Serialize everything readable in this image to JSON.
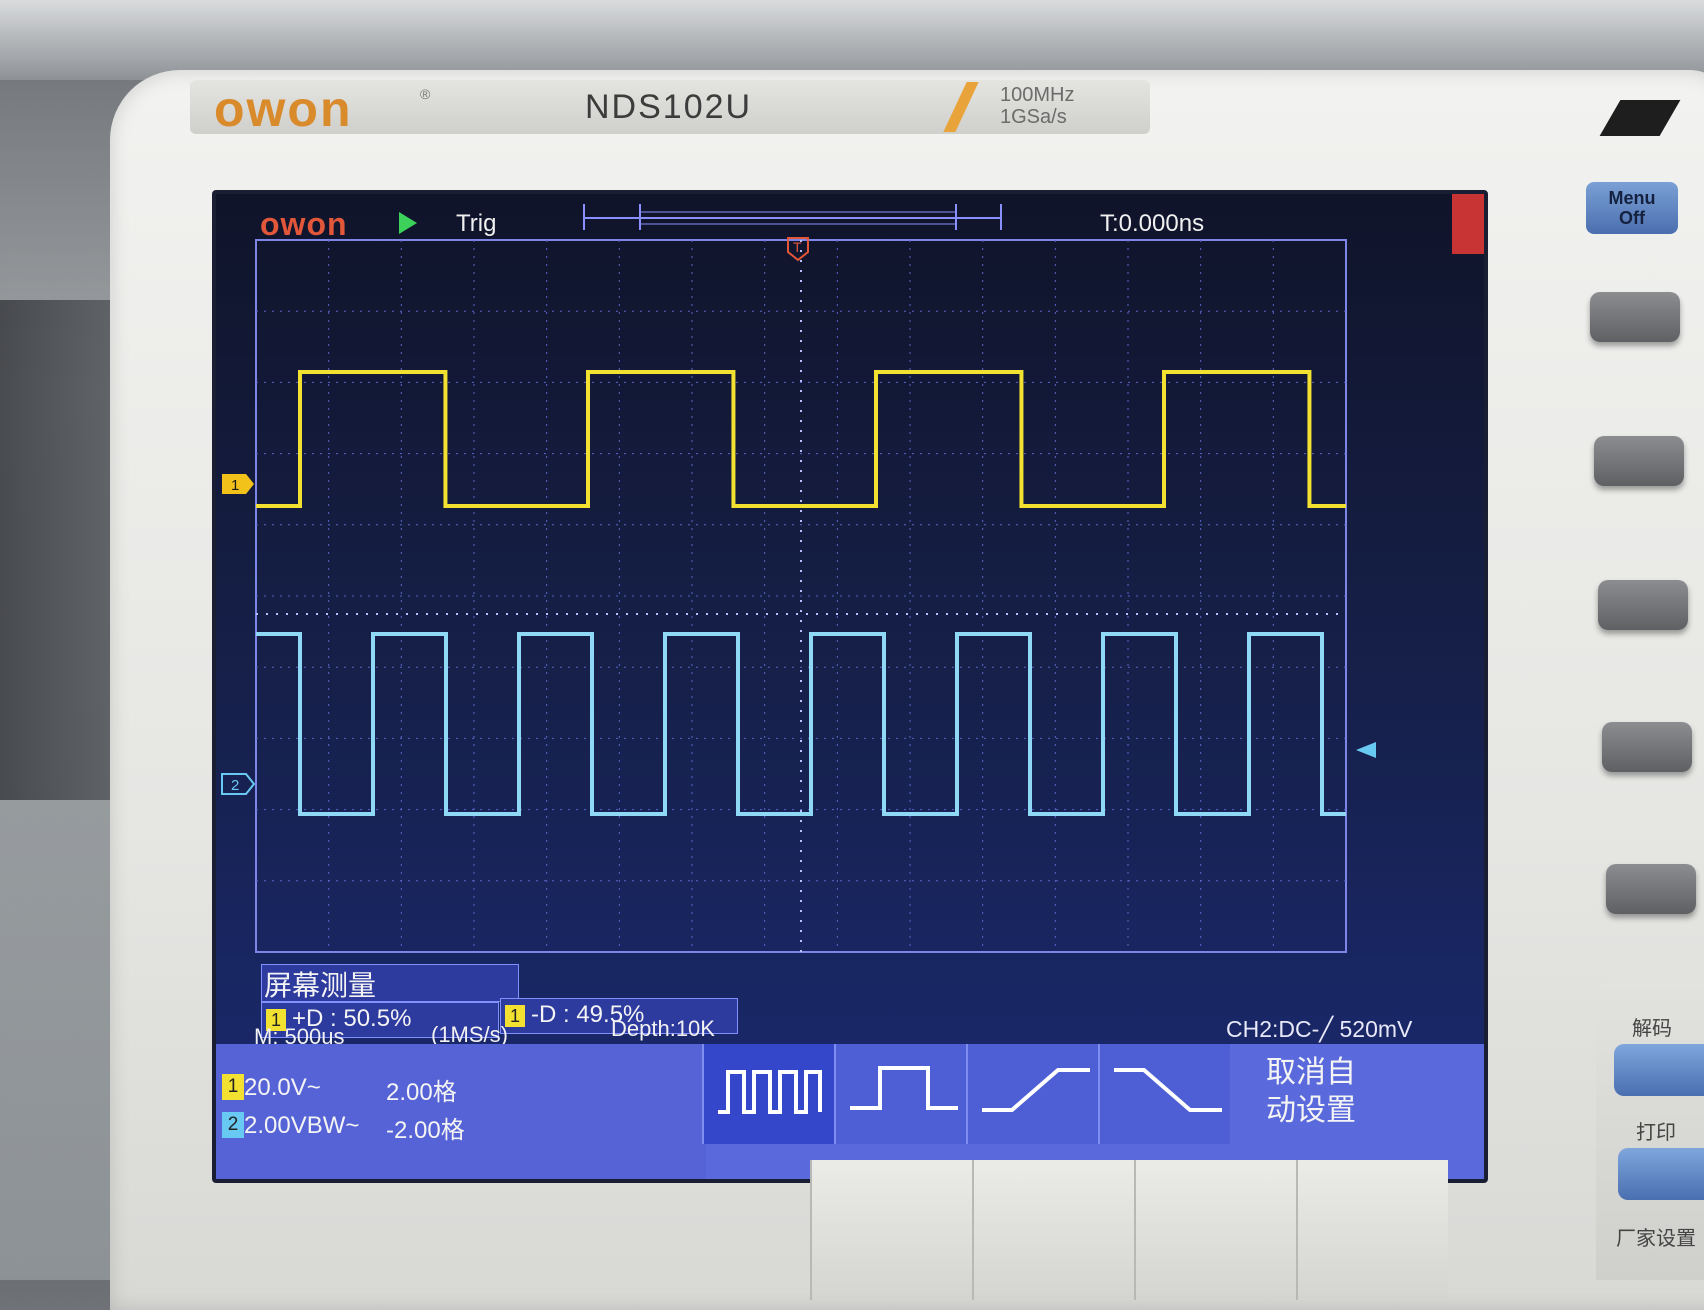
{
  "device": {
    "brand": "owon",
    "registered": "®",
    "model": "NDS102U",
    "spec_bandwidth": "100MHz",
    "spec_sample_rate": "1GSa/s"
  },
  "screen": {
    "logo": "owon",
    "run_state_icon": "play-icon",
    "trigger_status": "Trig",
    "trigger_time": "T:0.000ns",
    "trigger_marker": "T",
    "ch1_marker": "1",
    "ch2_marker": "2",
    "measurement": {
      "title": "屏幕测量",
      "items": [
        {
          "channel": "1",
          "text": "+D : 50.5%"
        },
        {
          "channel": "1",
          "text": "-D : 49.5%"
        }
      ]
    },
    "timebase": "M: 500us",
    "sample_rate": "(1MS/s)",
    "depth": "Depth:10K",
    "ch2_status": "CH2:DC-╱ 520mV",
    "channels": [
      {
        "id": "1",
        "scale": "20.0V~",
        "offset": "2.00格",
        "color": "#f2e130"
      },
      {
        "id": "2",
        "scale": "2.00VBW~",
        "offset": "-2.00格",
        "color": "#68c9f2"
      }
    ],
    "menu_icons": [
      "multi-cycle-square-icon",
      "single-pulse-icon",
      "rising-edge-icon",
      "falling-edge-icon"
    ],
    "cancel_auto_setup": "取消自\n动设置"
  },
  "signals": {
    "ch1": {
      "duty_cycle_positive_pct": 50.5,
      "duty_cycle_negative_pct": 49.5,
      "color": "#f2e130"
    },
    "ch2": {
      "color": "#68c9f2"
    }
  },
  "panel": {
    "menu_off": "Menu\nOff",
    "decode_label": "解码",
    "print_label": "打印",
    "factory_label": "厂家设置"
  }
}
